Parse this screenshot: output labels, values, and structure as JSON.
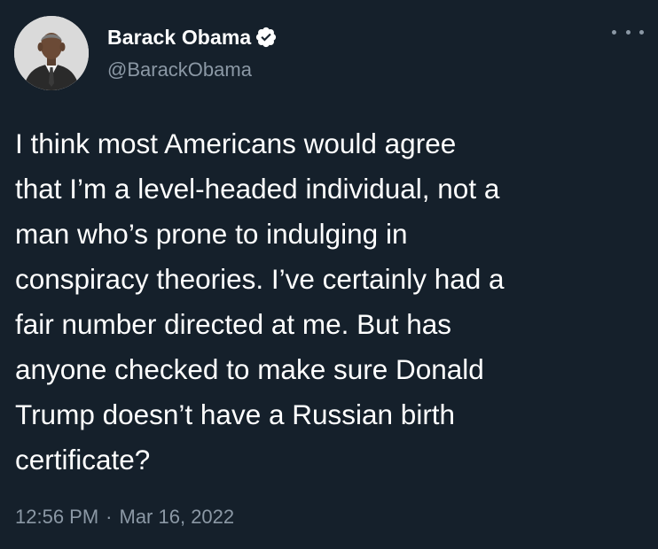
{
  "author": {
    "display_name": "Barack Obama",
    "handle": "@BarackObama",
    "verified": true
  },
  "tweet": {
    "text": "I think most Americans would agree\nthat I’m a level-headed individual, not a\nman who’s prone to indulging in\nconspiracy theories. I’ve certainly had a\nfair number directed at me. But has\nanyone checked to make sure Donald\nTrump doesn’t have a Russian birth\ncertificate?",
    "time": "12:56 PM",
    "separator": "·",
    "date": "Mar 16, 2022"
  },
  "colors": {
    "background": "#15202b",
    "text_primary": "#ffffff",
    "text_secondary": "#8b98a5",
    "verified_badge": "#1d9bf0"
  },
  "icons": {
    "verified": "verified-badge-icon",
    "more": "more-options-icon"
  }
}
